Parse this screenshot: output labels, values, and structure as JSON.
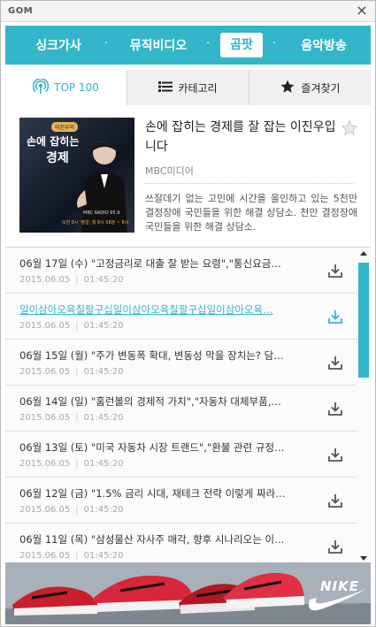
{
  "app": {
    "logo": "GOM",
    "close_glyph": "×"
  },
  "topnav": {
    "items": [
      {
        "label": "싱크가사"
      },
      {
        "label": "뮤직비디오"
      },
      {
        "label": "곰팟"
      },
      {
        "label": "음악방송"
      }
    ],
    "separator": "·",
    "active_index": 2
  },
  "tabs": [
    {
      "label": "TOP 100",
      "icon": "podcast-icon"
    },
    {
      "label": "카테고리",
      "icon": "list-icon"
    },
    {
      "label": "즐겨찾기",
      "icon": "star-icon"
    }
  ],
  "program": {
    "title": "손에 잡히는 경제를 잘 잡는 이진우입니다",
    "publisher": "MBC미디어",
    "description": "쓰잘데기 없는 고민에 시간을 올인하고 있는 5천만 결정장애 국민들을 위한 해결 상담소. 천만 결정장애 국민들을 위한 해결 상담소.",
    "thumbnail": {
      "badge": "이진우의",
      "line1": "손에 잡히는",
      "line2": "경제",
      "radio": "MBC RADIO 95.9",
      "time": "오전 8시 '평일',월 8시 58분 ~ 8시"
    },
    "favorite_icon": "star-outline-icon"
  },
  "episodes": [
    {
      "title": "06월 17일 (수) \"고정금리로 대출 잘 받는 요령\",\"통신요금…",
      "date": "2015.06.05",
      "duration": "01:45:20",
      "active": false
    },
    {
      "title": "일이삼아오육칠팔구십일이삼아오육칠팔구십일이삼아오육…",
      "date": "2015.06.05",
      "duration": "01:45:20",
      "active": true
    },
    {
      "title": "06월 15일 (월) \"주가 변동폭 확대, 변동성 막을 장치는? 담…",
      "date": "2015.06.05",
      "duration": "01:45:20",
      "active": false
    },
    {
      "title": "06월 14일 (일) \"홈런볼의 경제적 가치\",\"자동차 대체부품,…",
      "date": "2015.06.05",
      "duration": "01:45:20",
      "active": false
    },
    {
      "title": "06월 13일 (토) \"미국 자동차 시장 트랜드\",\"환불 관련 규정…",
      "date": "2015.06.05",
      "duration": "01:45:20",
      "active": false
    },
    {
      "title": "06월 12일 (금) \"1.5% 금리 시대, 재테크 전략 이렇게 짜라…",
      "date": "2015.06.05",
      "duration": "01:45:20",
      "active": false
    },
    {
      "title": "06월 11일 (목) \"삼성물산 자사주 매각, 향후 시나리오는 이…",
      "date": "2015.06.05",
      "duration": "01:45:20",
      "active": false
    }
  ],
  "ad": {
    "brand": "NIKE",
    "logo_icon": "nike-swoosh-icon"
  },
  "colors": {
    "accent": "#33b6c9",
    "text": "#333333",
    "muted": "#aaaaaa"
  }
}
